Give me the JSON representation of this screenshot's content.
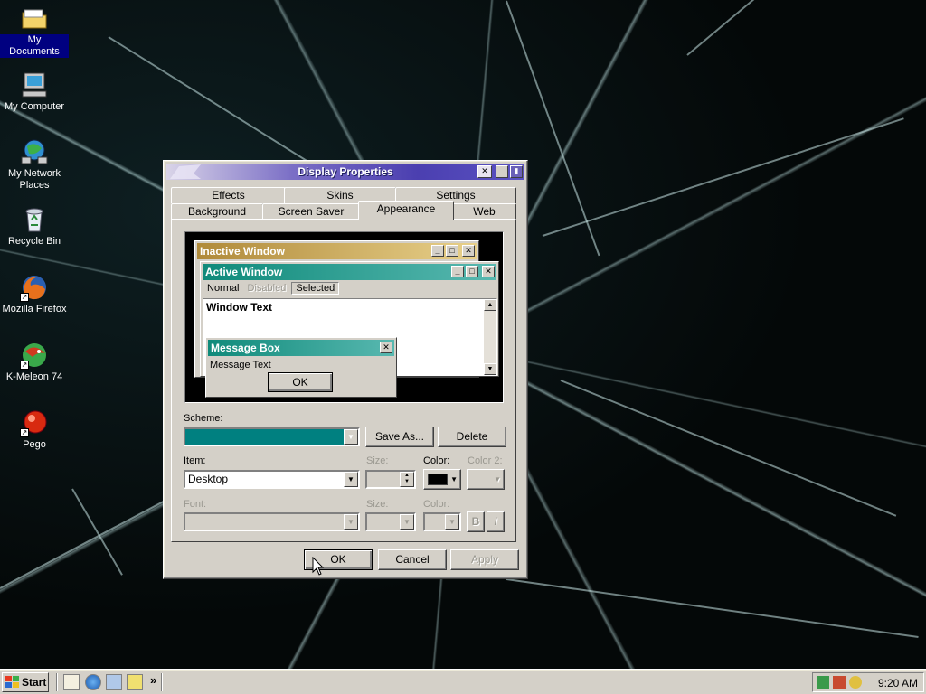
{
  "desktop": {
    "icons": [
      {
        "label": "My Documents",
        "icon": "folder-icon"
      },
      {
        "label": "My Computer",
        "icon": "computer-icon"
      },
      {
        "label": "My Network Places",
        "icon": "network-icon"
      },
      {
        "label": "Recycle Bin",
        "icon": "recycle-bin-icon"
      },
      {
        "label": "Mozilla Firefox",
        "icon": "firefox-icon"
      },
      {
        "label": "K-Meleon 74",
        "icon": "k-meleon-icon"
      },
      {
        "label": "Pego",
        "icon": "pego-icon"
      }
    ]
  },
  "window": {
    "title": "Display Properties",
    "tabs_row1": [
      "Effects",
      "Skins",
      "Settings"
    ],
    "tabs_row2": [
      "Background",
      "Screen Saver",
      "Appearance",
      "Web"
    ],
    "active_tab": "Appearance",
    "preview": {
      "inactive_title": "Inactive Window",
      "active_title": "Active Window",
      "menu": [
        "Normal",
        "Disabled",
        "Selected"
      ],
      "window_text": "Window Text",
      "message_title": "Message Box",
      "message_text": "Message Text",
      "ok_label": "OK"
    },
    "scheme": {
      "label": "Scheme:",
      "value": "",
      "save_as": "Save As...",
      "delete": "Delete",
      "color": "#008080"
    },
    "item": {
      "label": "Item:",
      "value": "Desktop",
      "size_label": "Size:",
      "color_label": "Color:",
      "color2_label": "Color 2:",
      "color_value": "#000000"
    },
    "font": {
      "label": "Font:",
      "size_label": "Size:",
      "color_label": "Color:",
      "bold": "B",
      "italic": "I"
    },
    "buttons": {
      "ok": "OK",
      "cancel": "Cancel",
      "apply": "Apply"
    }
  },
  "taskbar": {
    "start_label": "Start",
    "overflow": "»",
    "clock": "9:20 AM"
  },
  "colors": {
    "inactive_title": "#c8a85a",
    "active_title": "#2e9a8c",
    "selected": "#000080"
  }
}
